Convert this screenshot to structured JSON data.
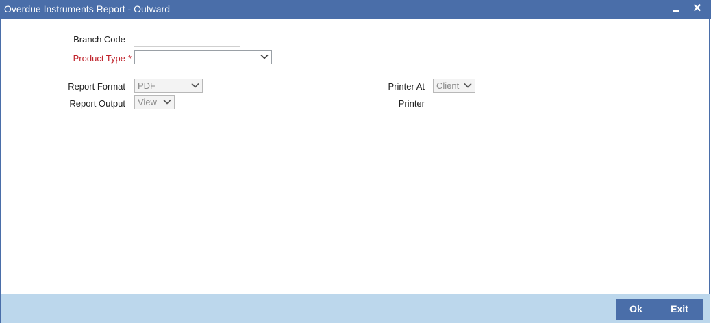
{
  "window": {
    "title": "Overdue Instruments Report - Outward",
    "minimize_icon": "minimize-icon",
    "close_icon": "close-icon",
    "close_glyph": "✕"
  },
  "form": {
    "branch_code": {
      "label": "Branch Code",
      "value": ""
    },
    "product_type": {
      "label": "Product Type",
      "required_marker": "*",
      "value": ""
    },
    "report_format": {
      "label": "Report Format",
      "value": "PDF"
    },
    "report_output": {
      "label": "Report Output",
      "value": "View"
    },
    "printer_at": {
      "label": "Printer At",
      "value": "Client"
    },
    "printer": {
      "label": "Printer",
      "value": ""
    }
  },
  "footer": {
    "ok_label": "Ok",
    "exit_label": "Exit"
  },
  "colors": {
    "titlebar": "#4a6ea9",
    "footer": "#bcd7ec",
    "required": "#c0222b",
    "button": "#4a6ea9"
  }
}
